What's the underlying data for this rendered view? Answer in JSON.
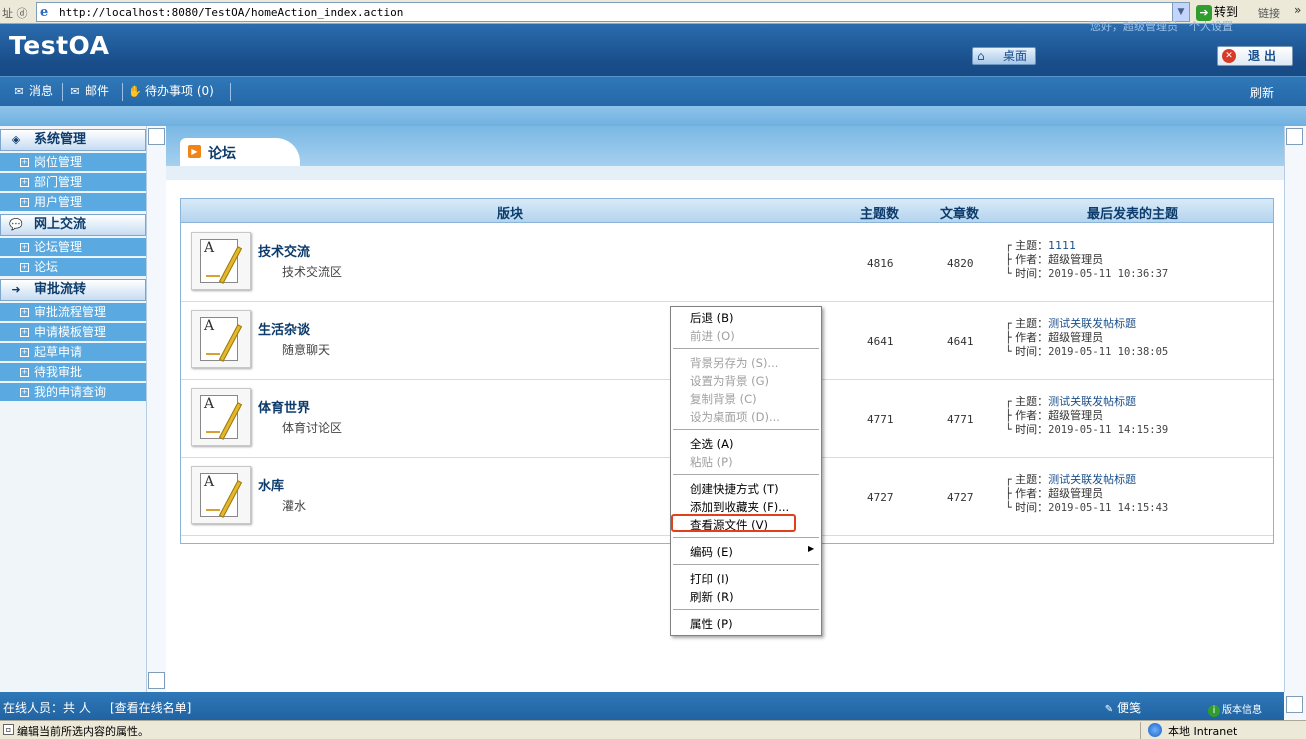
{
  "browser": {
    "address_label": "址 ⓓ",
    "url": "http://localhost:8080/TestOA/homeAction_index.action",
    "go_label": "转到",
    "links_label": "链接",
    "status_text": "编辑当前所选内容的属性。",
    "zone_text": "本地 Intranet"
  },
  "header": {
    "logo": "TestOA",
    "greeting": "您好，超级管理员　个人设置",
    "desktop_label": "桌面",
    "exit_label": "退出"
  },
  "toolbar": {
    "items": [
      {
        "label": "消息",
        "icon": "message-icon"
      },
      {
        "label": "邮件",
        "icon": "mail-icon"
      },
      {
        "label": "待办事项 (0)",
        "icon": "hand-icon"
      }
    ],
    "refresh_label": "刷新"
  },
  "sidebar": {
    "groups": [
      {
        "label": "系统管理",
        "icon": "cube-icon",
        "items": [
          "岗位管理",
          "部门管理",
          "用户管理"
        ]
      },
      {
        "label": "网上交流",
        "icon": "chat-icon",
        "items": [
          "论坛管理",
          "论坛"
        ]
      },
      {
        "label": "审批流转",
        "icon": "flow-icon",
        "items": [
          "审批流程管理",
          "申请模板管理",
          "起草申请",
          "待我审批",
          "我的申请查询"
        ]
      }
    ]
  },
  "main": {
    "tab_label": "论坛",
    "columns": [
      "版块",
      "主题数",
      "文章数",
      "最后发表的主题"
    ],
    "last_labels": {
      "topic": "┌ 主题：",
      "author": "├ 作者：",
      "time": "└ 时间："
    },
    "rows": [
      {
        "title": "技术交流",
        "desc": "技术交流区",
        "topics": "4816",
        "articles": "4820",
        "last_topic": "1111",
        "last_author": "超级管理员",
        "last_time": "2019-05-11 10:36:37"
      },
      {
        "title": "生活杂谈",
        "desc": "随意聊天",
        "topics": "4641",
        "articles": "4641",
        "last_topic": "测试关联发帖标题",
        "last_author": "超级管理员",
        "last_time": "2019-05-11 10:38:05"
      },
      {
        "title": "体育世界",
        "desc": "体育讨论区",
        "topics": "4771",
        "articles": "4771",
        "last_topic": "测试关联发帖标题",
        "last_author": "超级管理员",
        "last_time": "2019-05-11 14:15:39"
      },
      {
        "title": "水库",
        "desc": "灌水",
        "topics": "4727",
        "articles": "4727",
        "last_topic": "测试关联发帖标题",
        "last_author": "超级管理员",
        "last_time": "2019-05-11 14:15:43"
      }
    ]
  },
  "context_menu": {
    "back": "后退 (B)",
    "forward": "前进 (O)",
    "save_bg": "背景另存为 (S)...",
    "set_bg": "设置为背景 (G)",
    "copy_bg": "复制背景 (C)",
    "set_desktop": "设为桌面项 (D)...",
    "select_all": "全选 (A)",
    "paste": "粘贴 (P)",
    "shortcut": "创建快捷方式 (T)",
    "favorites": "添加到收藏夹 (F)...",
    "view_source": "查看源文件 (V)",
    "encoding": "编码 (E)",
    "print": "打印 (I)",
    "refresh": "刷新 (R)",
    "properties": "属性 (P)"
  },
  "bottom": {
    "online": "在线人员：共 人",
    "online_link": "[查看在线名单]",
    "note": "便笺",
    "version": "版本信息"
  }
}
